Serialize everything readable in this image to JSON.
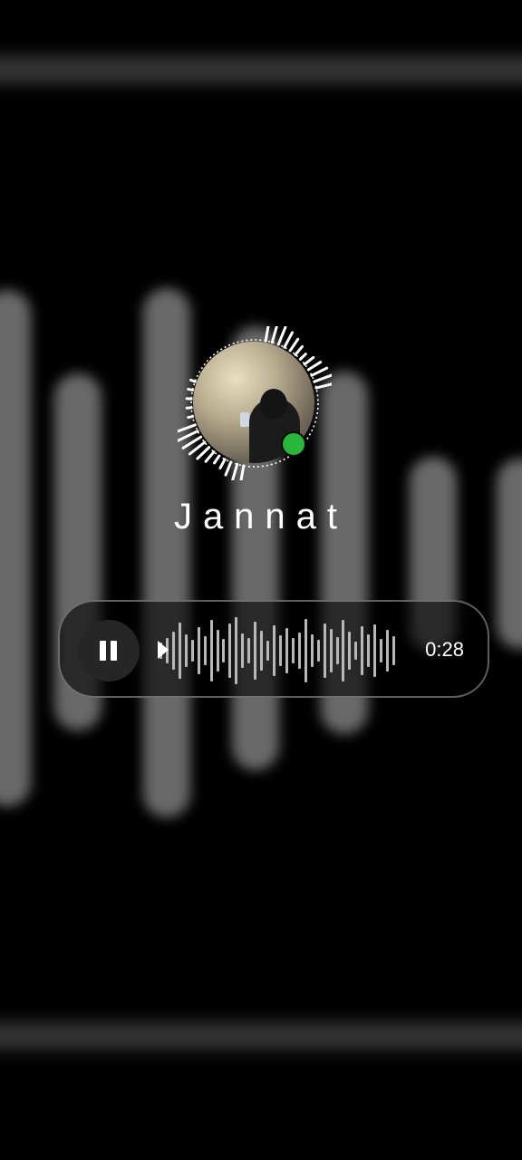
{
  "profile": {
    "name": "Jannat",
    "status": "online",
    "status_color": "#2ab53b"
  },
  "voice_note": {
    "duration": "0:28",
    "state": "playing",
    "progress": 0.0,
    "waveform_levels": [
      0.22,
      0.34,
      0.52,
      0.78,
      0.44,
      0.3,
      0.66,
      0.4,
      0.86,
      0.58,
      0.32,
      0.74,
      0.92,
      0.48,
      0.36,
      0.8,
      0.55,
      0.28,
      0.7,
      0.42,
      0.62,
      0.34,
      0.5,
      0.88,
      0.46,
      0.3,
      0.76,
      0.6,
      0.38,
      0.84,
      0.52,
      0.26,
      0.68,
      0.44,
      0.72,
      0.32,
      0.58,
      0.4
    ]
  },
  "icons": {
    "pause": "pause-icon",
    "online": "online-dot-icon"
  },
  "colors": {
    "background": "#000000",
    "accent_green": "#2ab53b",
    "text": "#ffffff"
  }
}
